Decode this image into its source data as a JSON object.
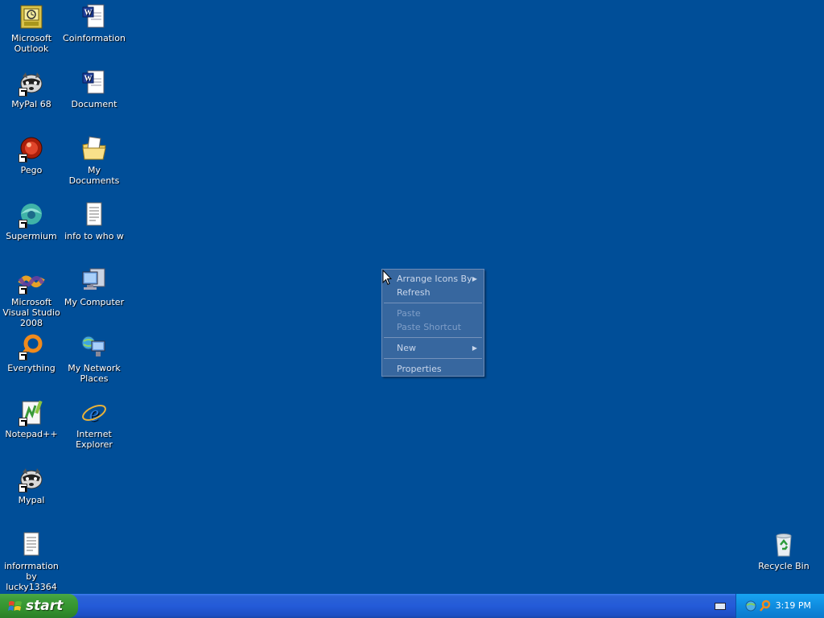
{
  "desktop": {
    "background": "#004e98",
    "icons": [
      {
        "label": "Microsoft Outlook",
        "icon": "outlook-icon",
        "shortcut": false
      },
      {
        "label": "Coinformation",
        "icon": "word-document-icon",
        "shortcut": false
      },
      {
        "label": "MyPal 68",
        "icon": "mypal-raccoon-icon",
        "shortcut": true
      },
      {
        "label": "Document",
        "icon": "word-document-icon",
        "shortcut": false
      },
      {
        "label": "Pego",
        "icon": "pego-icon",
        "shortcut": true
      },
      {
        "label": "My Documents",
        "icon": "my-documents-icon",
        "shortcut": false
      },
      {
        "label": "Supermium",
        "icon": "supermium-icon",
        "shortcut": true
      },
      {
        "label": "info to who w",
        "icon": "text-file-icon",
        "shortcut": false
      },
      {
        "label": "Microsoft Visual Studio 2008",
        "icon": "visual-studio-icon",
        "shortcut": true
      },
      {
        "label": "My Computer",
        "icon": "my-computer-icon",
        "shortcut": false
      },
      {
        "label": "Everything",
        "icon": "everything-search-icon",
        "shortcut": true
      },
      {
        "label": "My Network Places",
        "icon": "network-places-icon",
        "shortcut": false
      },
      {
        "label": "Notepad++",
        "icon": "notepadpp-icon",
        "shortcut": true
      },
      {
        "label": "Internet Explorer",
        "icon": "internet-explorer-icon",
        "shortcut": false
      },
      {
        "label": "Mypal",
        "icon": "mypal-raccoon-icon",
        "shortcut": true
      },
      {
        "label": "inforrmation by lucky13364",
        "icon": "text-file-icon",
        "shortcut": false
      },
      {
        "label": "Recycle Bin",
        "icon": "recycle-bin-icon",
        "shortcut": false
      }
    ]
  },
  "context_menu": {
    "items": [
      {
        "label": "Arrange Icons By",
        "submenu": true,
        "disabled": false
      },
      {
        "label": "Refresh",
        "submenu": false,
        "disabled": false
      },
      {
        "label": "Paste",
        "submenu": false,
        "disabled": true
      },
      {
        "label": "Paste Shortcut",
        "submenu": false,
        "disabled": true
      },
      {
        "label": "New",
        "submenu": true,
        "disabled": false
      },
      {
        "label": "Properties",
        "submenu": false,
        "disabled": false
      }
    ]
  },
  "taskbar": {
    "start_label": "start",
    "clock": "3:19 PM"
  }
}
